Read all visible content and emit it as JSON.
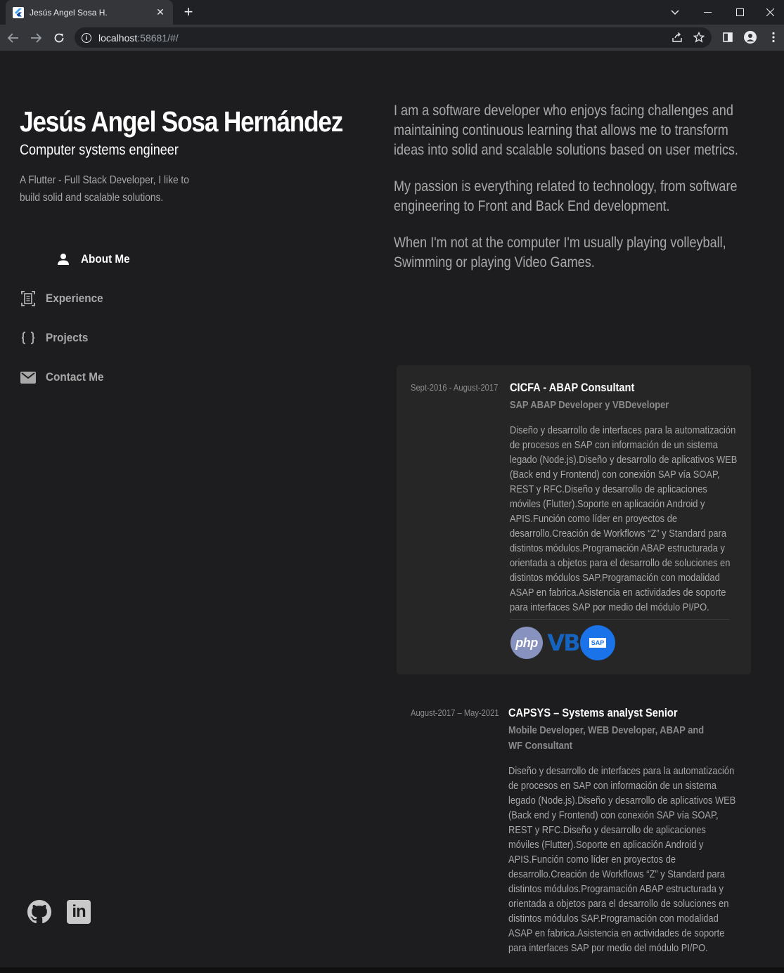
{
  "browser": {
    "tab_title": "Jesús Angel Sosa H.",
    "tab_close": "✕",
    "new_tab": "+",
    "url_host": "localhost",
    "url_rest": ":58681/#/"
  },
  "header": {
    "name": "Jesús Angel Sosa Hernández",
    "role": "Computer systems engineer",
    "tagline": "A Flutter - Full Stack Developer, I like to build solid and scalable solutions."
  },
  "nav": {
    "items": [
      {
        "label": "About Me",
        "icon": "person-icon",
        "active": true
      },
      {
        "label": "Experience",
        "icon": "document-scan-icon",
        "active": false
      },
      {
        "label": "Projects",
        "icon": "code-braces-icon",
        "active": false
      },
      {
        "label": "Contact Me",
        "icon": "mail-icon",
        "active": false
      }
    ]
  },
  "about": {
    "p1": "I am a software developer who enjoys facing challenges and maintaining continuous learning that allows me to transform ideas into solid and scalable solutions based on user metrics.",
    "p2": "My passion is everything related to technology, from software engineering to Front and Back End development.",
    "p3": "When I'm not at the computer I'm usually playing volleyball, Swimming or playing Video Games."
  },
  "experience": [
    {
      "date": "Sept-2016 - August-2017",
      "title": "CICFA - ABAP Consultant",
      "subtitle": "SAP ABAP Developer y VBDeveloper",
      "description": "Diseño y desarrollo de interfaces para la automatización de procesos en SAP con información de un sistema legado (Node.js).Diseño y desarrollo de aplicativos WEB (Back end y Frontend) con conexión SAP vía SOAP, REST y RFC.Diseño y desarrollo de aplicaciones móviles (Flutter).Soporte en aplicación Android y APIS.Función como líder en proyectos de desarrollo.Creación de Workflows “Z” y Standard para distintos módulos.Programación ABAP estructurada y orientada a objetos para el desarrollo de soluciones en distintos módulos SAP.Programación con modalidad ASAP en fabrica.Asistencia en actividades de soporte para interfaces SAP por medio del módulo PI/PO.",
      "tech": [
        "php",
        "VB",
        "SAP"
      ]
    },
    {
      "date": "August-2017 – May-2021",
      "title": "CAPSYS – Systems analyst Senior",
      "subtitle": "Mobile Developer, WEB Developer, ABAP and WF Consultant",
      "description": "Diseño y desarrollo de interfaces para la automatización de procesos en SAP con información de un sistema legado (Node.js).Diseño y desarrollo de aplicativos WEB (Back end y Frontend) con conexión SAP vía SOAP, REST y RFC.Diseño y desarrollo de aplicaciones móviles (Flutter).Soporte en aplicación Android y APIS.Función como líder en proyectos de desarrollo.Creación de Workflows “Z” y Standard para distintos módulos.Programación ABAP estructurada y orientada a objetos para el desarrollo de soluciones en distintos módulos SAP.Programación con modalidad ASAP en fabrica.Asistencia en actividades de soporte para interfaces SAP por medio del módulo PI/PO."
    }
  ],
  "social": [
    {
      "name": "github-icon"
    },
    {
      "name": "linkedin-icon",
      "label": "in"
    }
  ]
}
